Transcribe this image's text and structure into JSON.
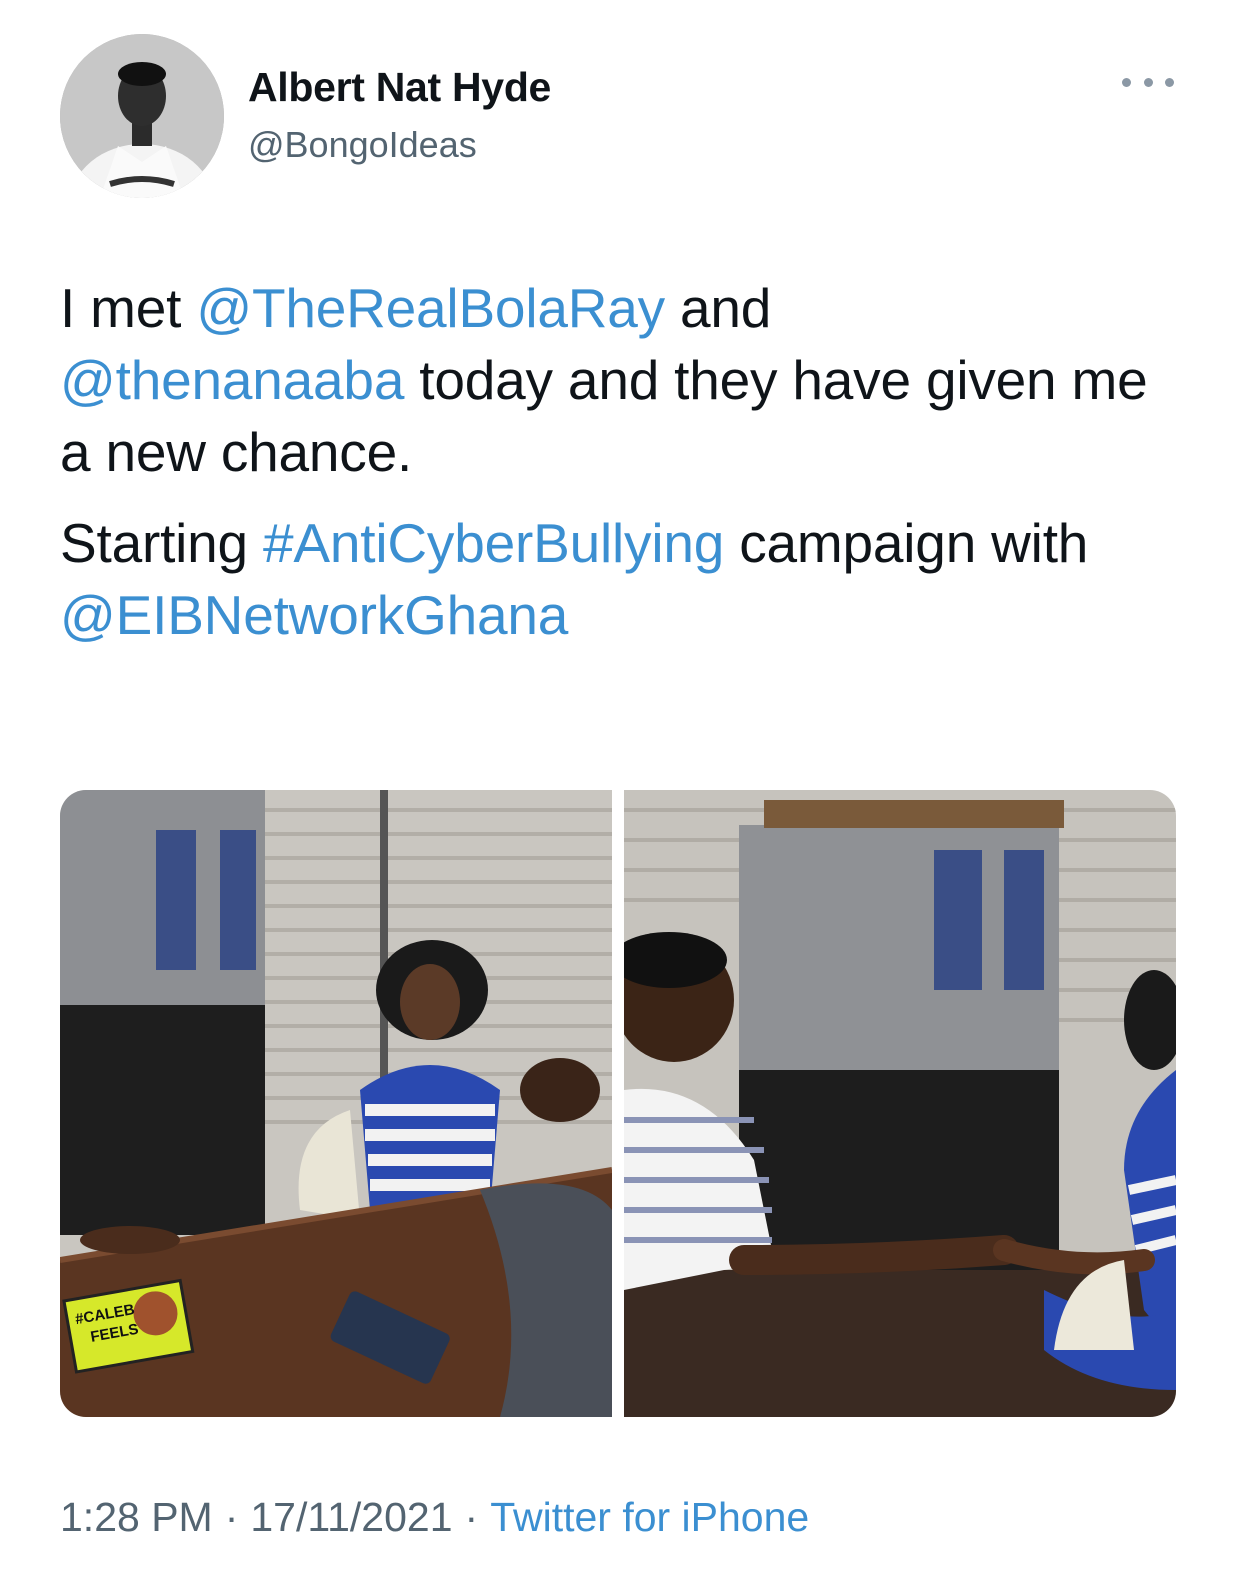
{
  "author": {
    "name": "Albert Nat Hyde",
    "handle": "@BongoIdeas",
    "avatar_icon": "profile-photo"
  },
  "more_icon": "more-horizontal-icon",
  "tweet": {
    "paragraph1": {
      "t1": "I met ",
      "mention1": "@TheRealBolaRay",
      "t2": " and",
      "mention2": "@thenanaaba",
      "t3": " today and they have given me a new chance."
    },
    "paragraph2": {
      "t1": "Starting ",
      "hashtag": "#AntiCyberBullying",
      "t2": " campaign with ",
      "mention": "@EIBNetworkGhana"
    }
  },
  "media": {
    "photos": [
      {
        "description_icon": "photo-meeting-table",
        "sticker_text": "#CALEB FEELS"
      },
      {
        "description_icon": "photo-handshake"
      }
    ]
  },
  "footer": {
    "time": "1:28 PM",
    "date": "17/11/2021",
    "separator": "·",
    "source": "Twitter for iPhone"
  },
  "colors": {
    "link": "#3b8fd1",
    "secondary_text": "#536471",
    "primary_text": "#0f1419"
  }
}
